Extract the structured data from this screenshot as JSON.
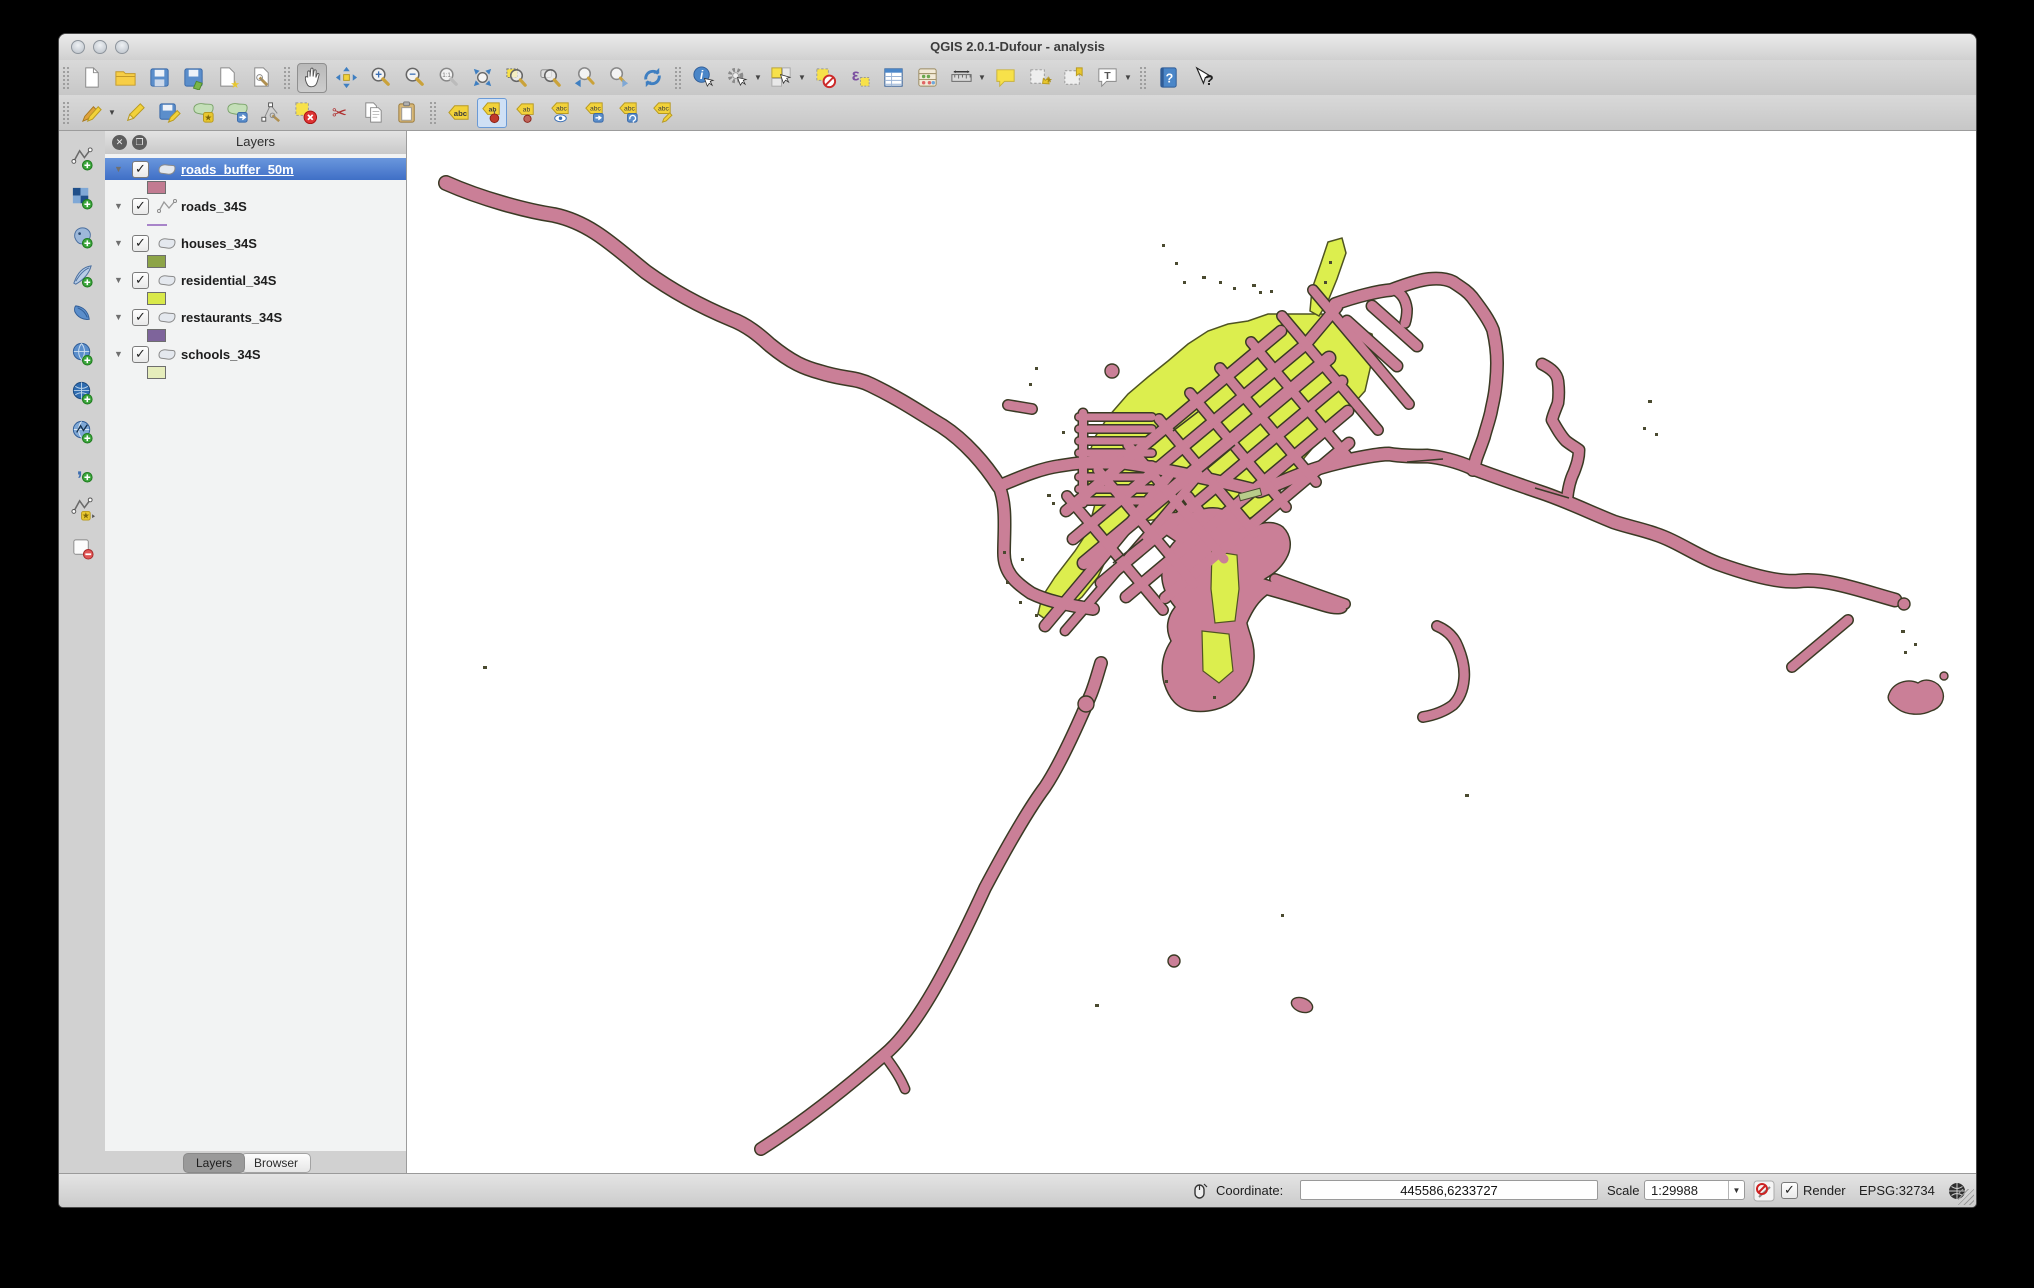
{
  "window": {
    "title": "QGIS 2.0.1-Dufour - analysis"
  },
  "toolbar_row1_icons": [
    "new-project",
    "open-project",
    "save-project",
    "save-project-as",
    "new-print-composer",
    "composer-manager",
    "pan-map",
    "pan-to-selection",
    "zoom-in",
    "zoom-out",
    "zoom-native",
    "zoom-full",
    "zoom-to-selection",
    "zoom-to-layer",
    "zoom-last",
    "zoom-next",
    "refresh-map",
    "identify-features",
    "run-feature-action",
    "select-features",
    "deselect-features",
    "select-by-expression",
    "open-attribute-table",
    "field-calculator",
    "measure",
    "map-tips",
    "new-bookmark",
    "show-bookmarks",
    "text-annotation",
    "help-contents",
    "whats-this"
  ],
  "toolbar_row2_icons": [
    "current-edits",
    "toggle-editing",
    "save-layer-edits",
    "add-feature",
    "move-feature",
    "node-tool",
    "delete-selected",
    "cut-features",
    "copy-features",
    "paste-features",
    "labeling",
    "label-pin-selected",
    "label-pin",
    "label-show-hide",
    "label-move",
    "label-rotate",
    "label-properties"
  ],
  "dock_icons": [
    "add-vector-layer",
    "add-raster-layer",
    "add-postgis-layer",
    "add-spatialite-layer",
    "add-mssql-layer",
    "add-wms-layer",
    "add-wcs-layer",
    "add-wfs-layer",
    "add-delimited-text-layer",
    "new-shapefile-layer",
    "remove-layer"
  ],
  "layers_panel": {
    "title": "Layers",
    "items": [
      {
        "name": "roads_buffer_50m",
        "checked": true,
        "selected": true,
        "geometry": "polygon",
        "swatch": "#c27b91"
      },
      {
        "name": "roads_34S",
        "checked": true,
        "selected": false,
        "geometry": "line",
        "swatch": "#a884c9"
      },
      {
        "name": "houses_34S",
        "checked": true,
        "selected": false,
        "geometry": "polygon",
        "swatch": "#8da447"
      },
      {
        "name": "residential_34S",
        "checked": true,
        "selected": false,
        "geometry": "polygon",
        "swatch": "#d9e94a"
      },
      {
        "name": "restaurants_34S",
        "checked": true,
        "selected": false,
        "geometry": "polygon",
        "swatch": "#7e649b"
      },
      {
        "name": "schools_34S",
        "checked": true,
        "selected": false,
        "geometry": "polygon",
        "swatch": "#e6edbb"
      }
    ],
    "tabs": [
      {
        "label": "Layers",
        "active": true
      },
      {
        "label": "Browser",
        "active": false
      }
    ],
    "check_glyph": "✓",
    "expand_glyph": "▼"
  },
  "map": {
    "background": "#ffffff",
    "road_buffer_color": "#ca7f97",
    "residential_color": "#dcee4e",
    "outline_color": "#3a3a24",
    "houses_color": "#4a4a30",
    "schools_color": "#b8cc8a"
  },
  "statusbar": {
    "coordinate_label": "Coordinate:",
    "coordinate_value": "445586,6233727",
    "scale_label": "Scale",
    "scale_value": "1:29988",
    "render_label": "Render",
    "render_checked": true,
    "crs_label": "EPSG:32734"
  }
}
